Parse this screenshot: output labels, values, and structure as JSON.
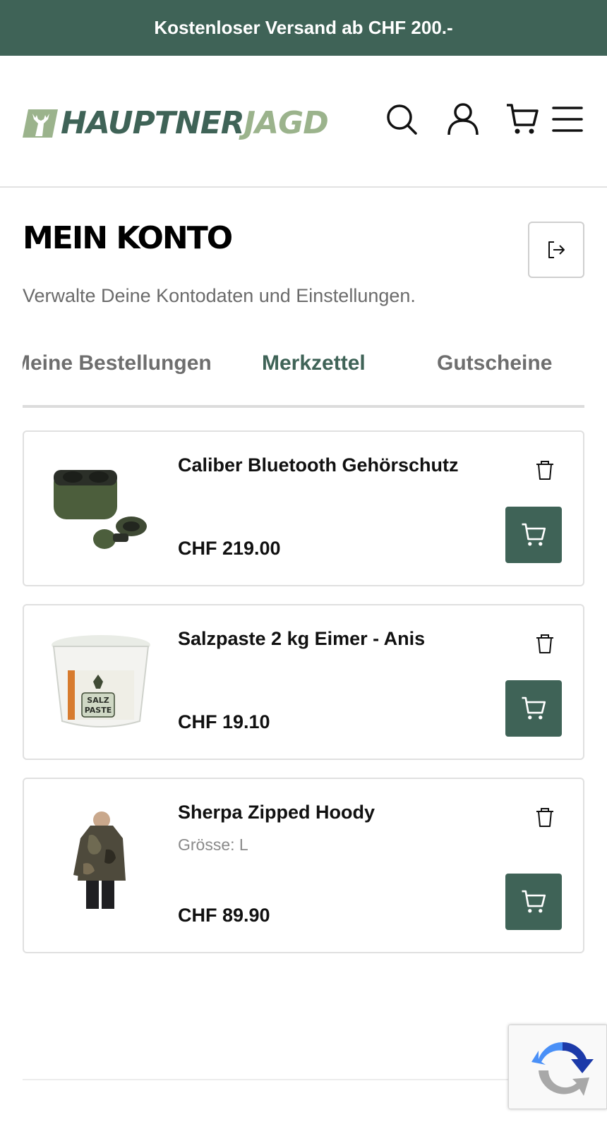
{
  "topbar": {
    "text": "Kostenloser Versand ab CHF 200.-"
  },
  "header": {
    "logo_text_a": "HAUPTNER",
    "logo_text_b": "JAGD",
    "icons": [
      "search-icon",
      "user-icon",
      "cart-icon",
      "menu-icon"
    ]
  },
  "page": {
    "title": "MEIN KONTO",
    "subtitle": "Verwalte Deine Kontodaten und Einstellungen.",
    "logout_icon": "logout-icon"
  },
  "tabs": [
    {
      "label": "Meine Bestellungen",
      "active": false
    },
    {
      "label": "Merkzettel",
      "active": true
    },
    {
      "label": "Gutscheine",
      "active": false
    }
  ],
  "wishlist": [
    {
      "name": "Caliber Bluetooth Gehörschutz",
      "variant": "",
      "price": "CHF 219.00",
      "image": "earbuds-image"
    },
    {
      "name": "Salzpaste 2 kg Eimer - Anis",
      "variant": "",
      "price": "CHF 19.10",
      "image": "bucket-image",
      "bucket_label_top": "SALZ",
      "bucket_label_bottom": "PASTE"
    },
    {
      "name": "Sherpa Zipped Hoody",
      "variant": "Grösse: L",
      "price": "CHF 89.90",
      "image": "hoody-image"
    }
  ],
  "colors": {
    "brand": "#3f6357",
    "brand_light": "#9bb38c",
    "muted": "#6e6e6e"
  }
}
